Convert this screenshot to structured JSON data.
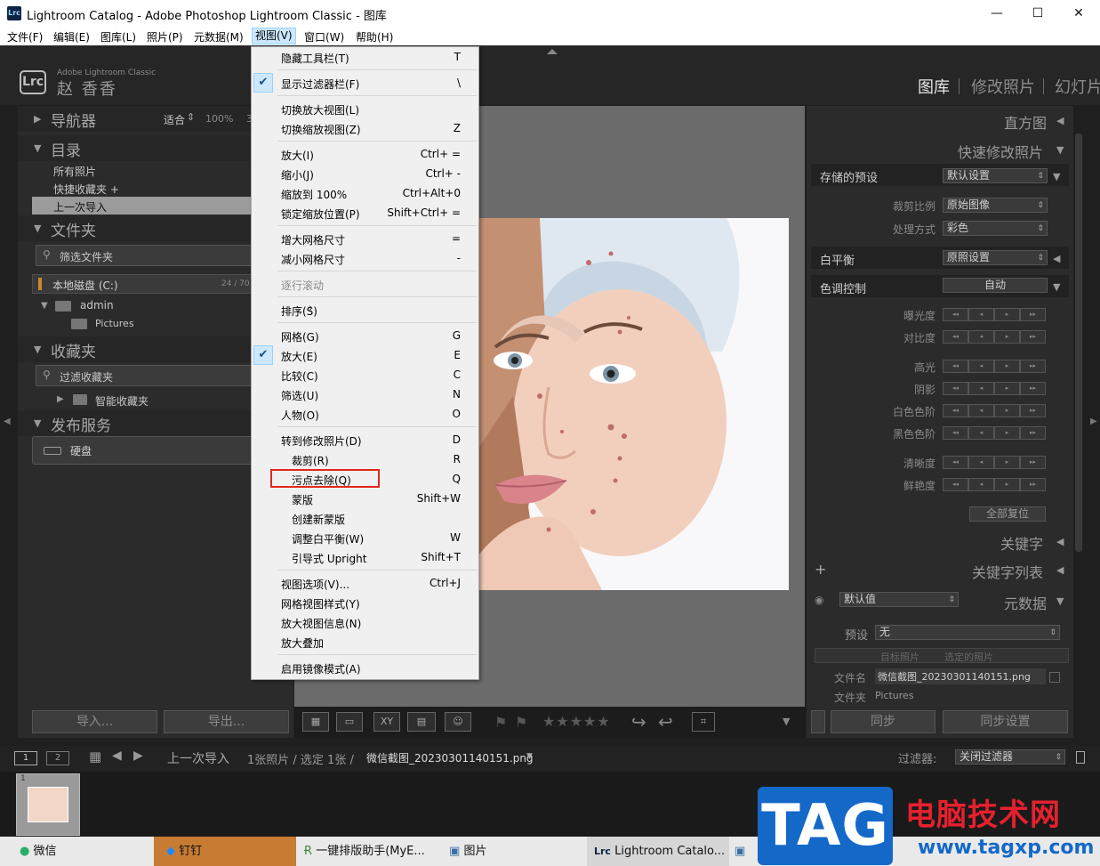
{
  "window": {
    "title": "Lightroom Catalog - Adobe Photoshop Lightroom Classic - 图库",
    "icon_text": "Lrc",
    "minimize": "—",
    "maximize": "☐",
    "close": "✕"
  },
  "menubar": [
    "文件(F)",
    "编辑(E)",
    "图库(L)",
    "照片(P)",
    "元数据(M)",
    "视图(V)",
    "窗口(W)",
    "帮助(H)"
  ],
  "identity": {
    "logo": "Lrc",
    "product": "Adobe Lightroom Classic",
    "user": "赵 香香",
    "modules": [
      "图库",
      "修改照片",
      "幻灯片"
    ]
  },
  "left": {
    "navigator": {
      "title": "导航器",
      "fit": "适合",
      "zoom": "100%",
      "more": "3"
    },
    "catalog": {
      "title": "目录",
      "items": [
        "所有照片",
        "快捷收藏夹 +",
        "上一次导入"
      ]
    },
    "folders": {
      "title": "文件夹",
      "search": "筛选文件夹",
      "volume": "本地磁盘 (C:)",
      "volume_size": "24 / 70",
      "tree": [
        "admin",
        "Pictures"
      ]
    },
    "collections": {
      "title": "收藏夹",
      "search": "过滤收藏夹",
      "items": [
        "智能收藏夹"
      ]
    },
    "publish": {
      "title": "发布服务",
      "items": [
        "硬盘"
      ]
    },
    "import_btn": "导入...",
    "export_btn": "导出..."
  },
  "right": {
    "histogram": "直方图",
    "quick_develop": "快速修改照片",
    "saved_preset_label": "存储的预设",
    "saved_preset_value": "默认设置",
    "crop_label": "裁剪比例",
    "crop_value": "原始图像",
    "treatment_label": "处理方式",
    "treatment_value": "彩色",
    "wb_label": "白平衡",
    "wb_value": "原照设置",
    "tone_label": "色调控制",
    "tone_value": "自动",
    "sliders_a": [
      "曝光度",
      "对比度"
    ],
    "sliders_b": [
      "高光",
      "阴影",
      "白色色阶",
      "黑色色阶"
    ],
    "sliders_c": [
      "清晰度",
      "鲜艳度"
    ],
    "step_glyphs": [
      "◂◂",
      "◂",
      "▸",
      "▸▸"
    ],
    "reset_all": "全部复位",
    "keywording": "关键字",
    "keyword_list": "关键字列表",
    "metadata_preset": "默认值",
    "metadata": "元数据",
    "preset_label": "预设",
    "preset_value": "无",
    "target_photo": "目标照片",
    "selected_photos": "选定的照片",
    "filename_label": "文件名",
    "filename_value": "微信截图_20230301140151.png",
    "folder_label": "文件夹",
    "folder_value": "Pictures",
    "sync": "同步",
    "sync_settings": "同步设置"
  },
  "filmbar": {
    "screen1": "1",
    "screen2": "2",
    "breadcrumb": "上一次导入",
    "count": "1张照片 / 选定 1张 /",
    "filename": "微信截图_20230301140151.png",
    "filter_label": "过滤器:",
    "filter_value": "关闭过滤器",
    "thumb_index": "1"
  },
  "view_menu": [
    {
      "label": "隐藏工具栏(T)",
      "shortcut": "T"
    },
    {
      "sep": true
    },
    {
      "label": "显示过滤器栏(F)",
      "shortcut": "\\",
      "checked": true
    },
    {
      "sep": true
    },
    {
      "label": "切换放大视图(L)",
      "shortcut": ""
    },
    {
      "label": "切换缩放视图(Z)",
      "shortcut": "Z"
    },
    {
      "sep": true
    },
    {
      "label": "放大(I)",
      "shortcut": "Ctrl+ ="
    },
    {
      "label": "缩小(J)",
      "shortcut": "Ctrl+ -"
    },
    {
      "label": "缩放到 100%",
      "shortcut": "Ctrl+Alt+0"
    },
    {
      "label": "锁定缩放位置(P)",
      "shortcut": "Shift+Ctrl+ ="
    },
    {
      "sep": true
    },
    {
      "label": "增大网格尺寸",
      "shortcut": "="
    },
    {
      "label": "减小网格尺寸",
      "shortcut": "-"
    },
    {
      "sep": true
    },
    {
      "label": "逐行滚动",
      "shortcut": "",
      "disabled": true
    },
    {
      "sep": true
    },
    {
      "label": "排序(S)",
      "shortcut": "",
      "submenu": true
    },
    {
      "sep": true
    },
    {
      "label": "网格(G)",
      "shortcut": "G"
    },
    {
      "label": "放大(E)",
      "shortcut": "E",
      "checked": true
    },
    {
      "label": "比较(C)",
      "shortcut": "C"
    },
    {
      "label": "筛选(U)",
      "shortcut": "N"
    },
    {
      "label": "人物(O)",
      "shortcut": "O"
    },
    {
      "sep": true
    },
    {
      "label": "转到修改照片(D)",
      "shortcut": "D"
    },
    {
      "label": "裁剪(R)",
      "shortcut": "R",
      "indent": true
    },
    {
      "label": "污点去除(Q)",
      "shortcut": "Q",
      "indent": true
    },
    {
      "label": "蒙版",
      "shortcut": "Shift+W",
      "indent": true
    },
    {
      "label": "创建新蒙版",
      "shortcut": "",
      "indent": true,
      "submenu": true
    },
    {
      "label": "调整白平衡(W)",
      "shortcut": "W",
      "indent": true
    },
    {
      "label": "引导式 Upright",
      "shortcut": "Shift+T",
      "indent": true
    },
    {
      "sep": true
    },
    {
      "label": "视图选项(V)...",
      "shortcut": "Ctrl+J"
    },
    {
      "label": "网格视图样式(Y)",
      "shortcut": "",
      "submenu": true
    },
    {
      "label": "放大视图信息(N)",
      "shortcut": "",
      "submenu": true
    },
    {
      "label": "放大叠加",
      "shortcut": "",
      "submenu": true
    },
    {
      "sep": true
    },
    {
      "label": "启用镜像模式(A)",
      "shortcut": ""
    }
  ],
  "taskbar": [
    "微信",
    "钉钉",
    "一键排版助手(MyE...",
    "图片",
    "Lightroom Catalo..."
  ],
  "watermark": {
    "tag": "TAG",
    "cn": "电脑技术网",
    "url": "www.tagxp.com"
  },
  "colors": {
    "panel": "#2b2b2b",
    "center": "#6c6c6c",
    "menu_bg": "#f0f0f0",
    "highlight_box": "#e3261c",
    "check_bg": "#cce8ff"
  }
}
